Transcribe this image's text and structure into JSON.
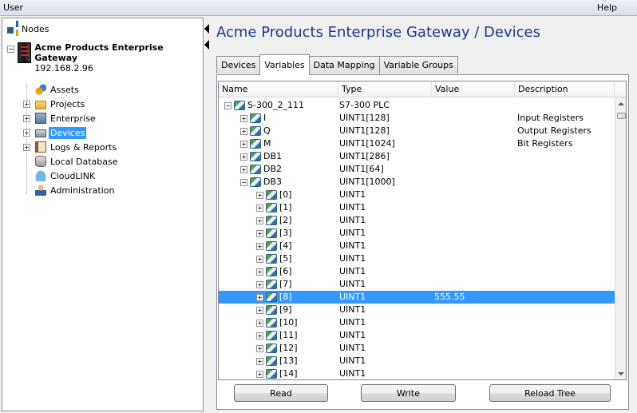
{
  "menu": {
    "user": "User",
    "help": "Help"
  },
  "left": {
    "nodes_label": "Nodes",
    "gateway": {
      "name": "Acme Products Enterprise Gateway",
      "ip": "192.168.2.96"
    },
    "items": [
      {
        "label": "Assets",
        "expander": false
      },
      {
        "label": "Projects",
        "expander": true
      },
      {
        "label": "Enterprise",
        "expander": true
      },
      {
        "label": "Devices",
        "expander": true,
        "selected": true
      },
      {
        "label": "Logs & Reports",
        "expander": true
      },
      {
        "label": "Local Database",
        "expander": false
      },
      {
        "label": "CloudLINK",
        "expander": false
      },
      {
        "label": "Administration",
        "expander": false
      }
    ]
  },
  "main": {
    "title": "Acme Products Enterprise Gateway / Devices",
    "tabs": [
      "Devices",
      "Variables",
      "Data Mapping",
      "Variable Groups"
    ],
    "active_tab": "Variables"
  },
  "grid": {
    "columns": [
      "Name",
      "Type",
      "Value",
      "Description"
    ],
    "rows": [
      {
        "name": "S-300_2_111",
        "type": "S7-300 PLC",
        "value": "",
        "desc": "",
        "level": 0,
        "expanded": true
      },
      {
        "name": "I",
        "type": "UINT1[128]",
        "value": "",
        "desc": "Input Registers",
        "level": 1,
        "expanded": false
      },
      {
        "name": "Q",
        "type": "UINT1[128]",
        "value": "",
        "desc": "Output Registers",
        "level": 1,
        "expanded": false
      },
      {
        "name": "M",
        "type": "UINT1[1024]",
        "value": "",
        "desc": "Bit Registers",
        "level": 1,
        "expanded": false
      },
      {
        "name": "DB1",
        "type": "UINT1[286]",
        "value": "",
        "desc": "",
        "level": 1,
        "expanded": false
      },
      {
        "name": "DB2",
        "type": "UINT1[64]",
        "value": "",
        "desc": "",
        "level": 1,
        "expanded": false
      },
      {
        "name": "DB3",
        "type": "UINT1[1000]",
        "value": "",
        "desc": "",
        "level": 1,
        "expanded": true
      },
      {
        "name": "[0]",
        "type": "UINT1",
        "value": "",
        "desc": "",
        "level": 2,
        "expanded": false
      },
      {
        "name": "[1]",
        "type": "UINT1",
        "value": "",
        "desc": "",
        "level": 2,
        "expanded": false
      },
      {
        "name": "[2]",
        "type": "UINT1",
        "value": "",
        "desc": "",
        "level": 2,
        "expanded": false
      },
      {
        "name": "[3]",
        "type": "UINT1",
        "value": "",
        "desc": "",
        "level": 2,
        "expanded": false
      },
      {
        "name": "[4]",
        "type": "UINT1",
        "value": "",
        "desc": "",
        "level": 2,
        "expanded": false
      },
      {
        "name": "[5]",
        "type": "UINT1",
        "value": "",
        "desc": "",
        "level": 2,
        "expanded": false
      },
      {
        "name": "[6]",
        "type": "UINT1",
        "value": "",
        "desc": "",
        "level": 2,
        "expanded": false
      },
      {
        "name": "[7]",
        "type": "UINT1",
        "value": "",
        "desc": "",
        "level": 2,
        "expanded": false
      },
      {
        "name": "[8]",
        "type": "UINT1",
        "value": "555.55",
        "desc": "",
        "level": 2,
        "expanded": false,
        "selected": true
      },
      {
        "name": "[9]",
        "type": "UINT1",
        "value": "",
        "desc": "",
        "level": 2,
        "expanded": false
      },
      {
        "name": "[10]",
        "type": "UINT1",
        "value": "",
        "desc": "",
        "level": 2,
        "expanded": false
      },
      {
        "name": "[11]",
        "type": "UINT1",
        "value": "",
        "desc": "",
        "level": 2,
        "expanded": false
      },
      {
        "name": "[12]",
        "type": "UINT1",
        "value": "",
        "desc": "",
        "level": 2,
        "expanded": false
      },
      {
        "name": "[13]",
        "type": "UINT1",
        "value": "",
        "desc": "",
        "level": 2,
        "expanded": false
      },
      {
        "name": "[14]",
        "type": "UINT1",
        "value": "",
        "desc": "",
        "level": 2,
        "expanded": false
      }
    ]
  },
  "buttons": {
    "read": "Read",
    "write": "Write",
    "reload": "Reload Tree"
  },
  "colors": {
    "selection": "#3399ff",
    "title": "#1b3a8c"
  }
}
